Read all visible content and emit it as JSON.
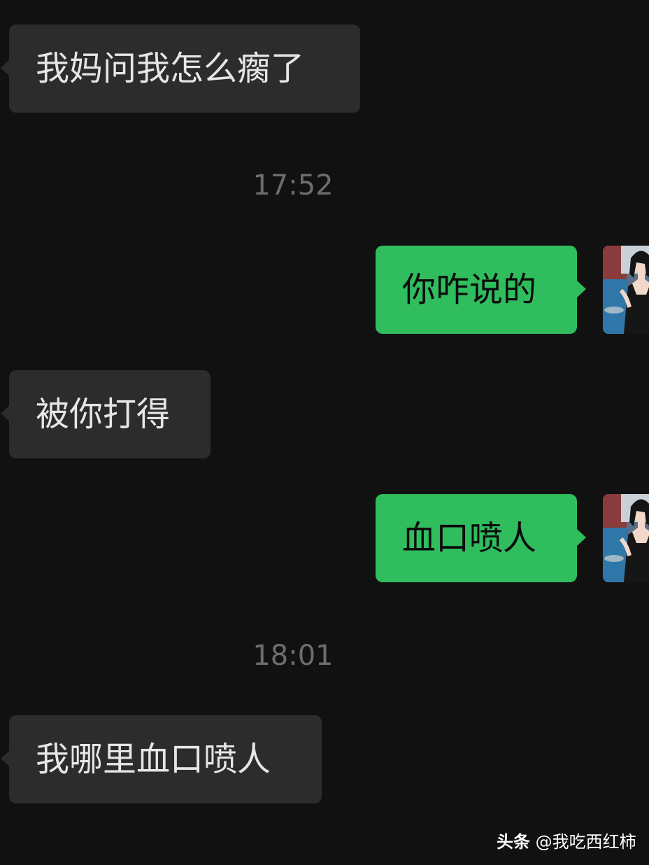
{
  "messages": [
    {
      "side": "in",
      "text": "我妈问我怎么瘸了"
    },
    {
      "type": "timestamp",
      "text": "17:52"
    },
    {
      "side": "out",
      "text": "你咋说的",
      "avatar": "profile-photo"
    },
    {
      "side": "in",
      "text": "被你打得"
    },
    {
      "side": "out",
      "text": "血口喷人",
      "avatar": "profile-photo"
    },
    {
      "type": "timestamp",
      "text": "18:01"
    },
    {
      "side": "in",
      "text": "我哪里血口喷人"
    }
  ],
  "watermark": {
    "brand": "头条",
    "handle": "@我吃西红柿"
  },
  "colors": {
    "background": "#111111",
    "incoming_bubble": "#2c2c2c",
    "outgoing_bubble": "#2fbd5e",
    "timestamp": "#6d6d6d"
  }
}
